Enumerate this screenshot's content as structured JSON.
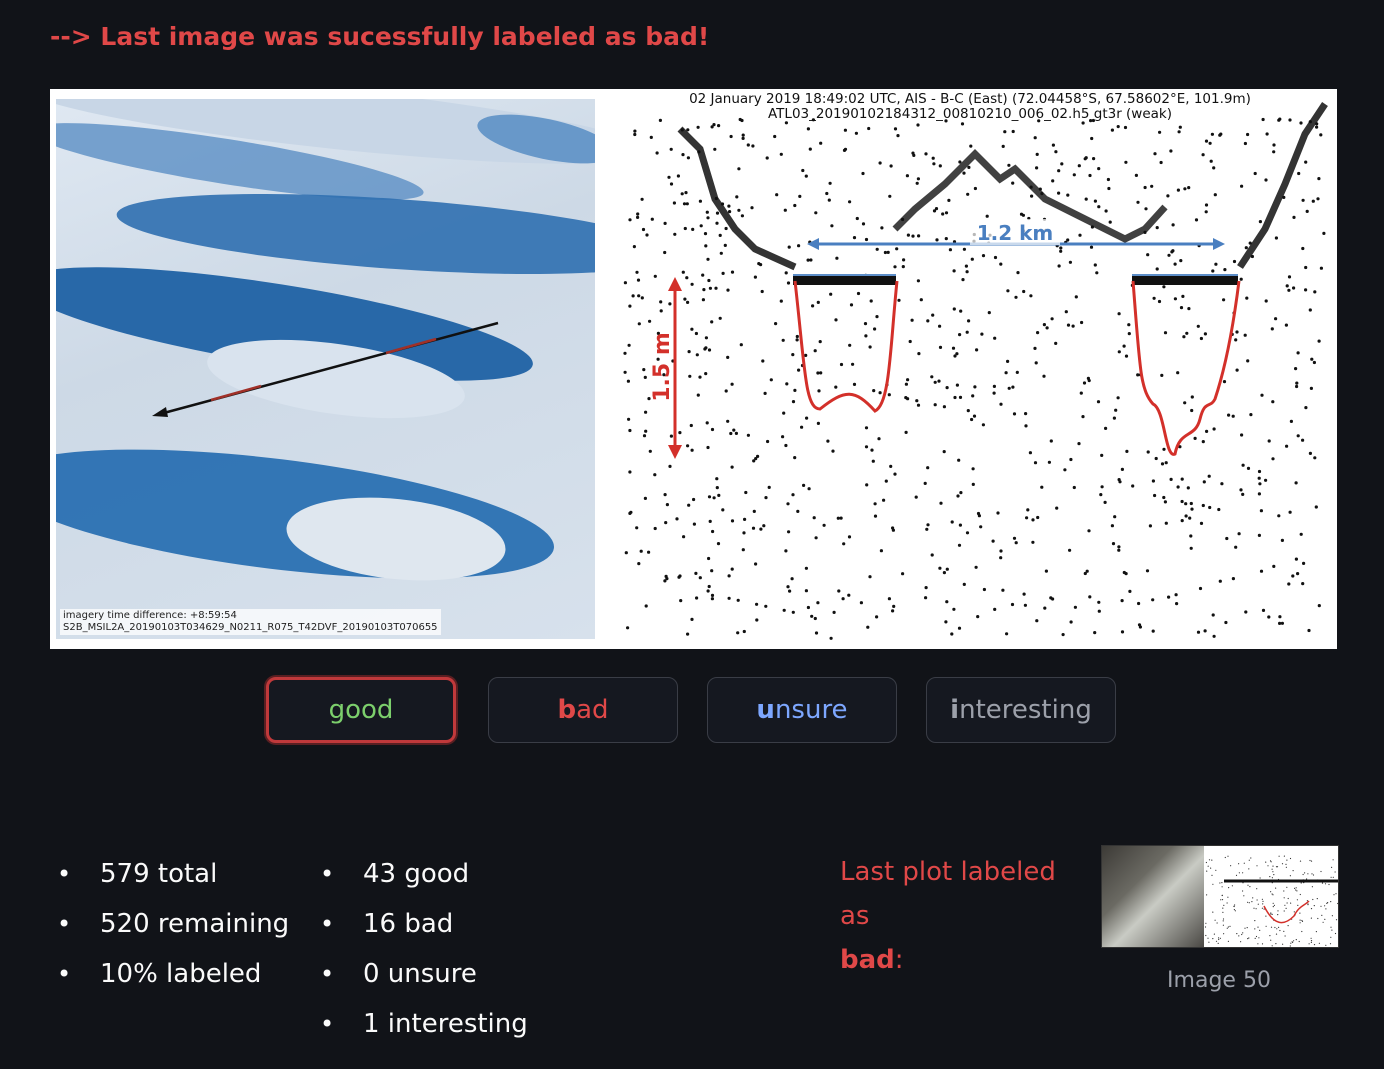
{
  "status": {
    "message": "--> Last image was sucessfully labeled as bad!"
  },
  "figure": {
    "sat_caption_line1": "imagery time difference: +8:59:54",
    "sat_caption_line2": "S2B_MSIL2A_20190103T034629_N0211_R075_T42DVF_20190103T070655",
    "plot_title_line1": "02 January 2019 18:49:02 UTC, AIS - B-C (East) (72.04458°S, 67.58602°E, 101.9m)",
    "plot_title_line2": "ATL03_20190102184312_00810210_006_02.h5 gt3r (weak)",
    "width_annotation": "1.2 km",
    "depth_annotation": "1.5 m"
  },
  "buttons": {
    "good": "good",
    "bad": "bad",
    "unsure": "unsure",
    "interesting": "interesting",
    "active": "good"
  },
  "stats": {
    "left": [
      "579 total",
      "520 remaining",
      "10% labeled"
    ],
    "right": [
      "43 good",
      "16 bad",
      "0 unsure",
      "1 interesting"
    ]
  },
  "last_plot": {
    "label_prefix": "Last plot labeled as",
    "label_value": "bad",
    "label_suffix": ":",
    "caption": "Image 50"
  },
  "colors": {
    "background": "#111318",
    "status_red": "#e04848",
    "good_green": "#7ccf6c",
    "unsure_blue": "#7da7ff",
    "interesting_gray": "#9ca0aa"
  }
}
